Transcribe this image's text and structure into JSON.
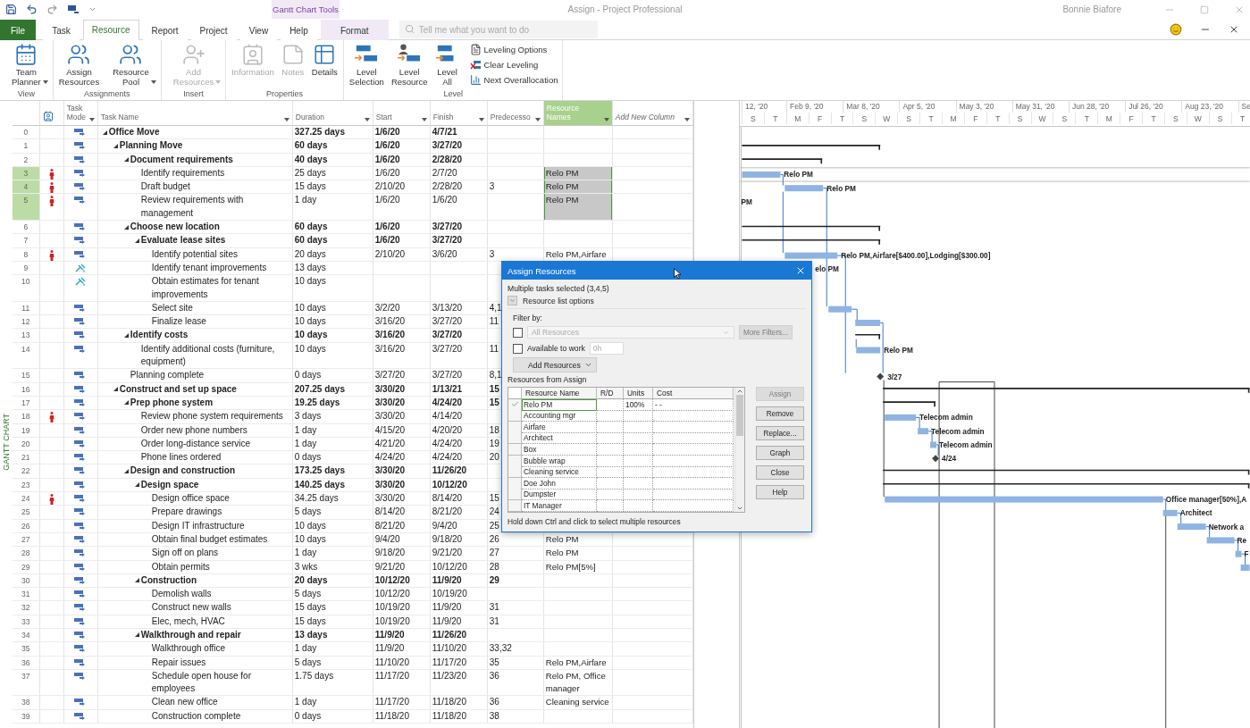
{
  "title_bar": {
    "context_group": "Gantt Chart Tools",
    "title": "Assign - Project Professional",
    "user": "Bonnie Biafore"
  },
  "tabs": [
    {
      "label": "File",
      "kind": "file",
      "selected": false
    },
    {
      "label": "Task",
      "kind": "normal",
      "selected": false
    },
    {
      "label": "Resource",
      "kind": "normal",
      "selected": true
    },
    {
      "label": "Report",
      "kind": "normal",
      "selected": false
    },
    {
      "label": "Project",
      "kind": "normal",
      "selected": false
    },
    {
      "label": "View",
      "kind": "normal",
      "selected": false
    },
    {
      "label": "Help",
      "kind": "normal",
      "selected": false
    },
    {
      "label": "Format",
      "kind": "context",
      "selected": false
    }
  ],
  "search": {
    "placeholder": "Tell me what you want to do"
  },
  "ribbon_groups": [
    {
      "label": "View",
      "buttons": [
        {
          "label": "Team Planner",
          "dropdown": true,
          "disabled": false
        }
      ]
    },
    {
      "label": "Assignments",
      "buttons": [
        {
          "label": "Assign Resources",
          "dropdown": false,
          "disabled": false
        },
        {
          "label": "Resource Pool",
          "dropdown": true,
          "disabled": false
        }
      ]
    },
    {
      "label": "Insert",
      "buttons": [
        {
          "label": "Add Resources",
          "dropdown": true,
          "disabled": true
        }
      ]
    },
    {
      "label": "Properties",
      "buttons": [
        {
          "label": "Information",
          "dropdown": false,
          "disabled": true
        },
        {
          "label": "Notes",
          "dropdown": false,
          "disabled": true
        },
        {
          "label": "Details",
          "dropdown": false,
          "disabled": false
        }
      ]
    },
    {
      "label": "Level",
      "buttons": [
        {
          "label": "Level Selection",
          "dropdown": false,
          "disabled": false
        },
        {
          "label": "Level Resource",
          "dropdown": false,
          "disabled": false
        },
        {
          "label": "Level All",
          "dropdown": false,
          "disabled": false
        }
      ],
      "small_buttons": [
        {
          "label": "Leveling Options"
        },
        {
          "label": "Clear Leveling"
        },
        {
          "label": "Next Overallocation"
        }
      ]
    }
  ],
  "view_label": "GANTT CHART",
  "table": {
    "columns": [
      {
        "label": "Task Mode",
        "selected": false
      },
      {
        "label": "Task Name",
        "selected": false
      },
      {
        "label": "Duration",
        "selected": false
      },
      {
        "label": "Start",
        "selected": false
      },
      {
        "label": "Finish",
        "selected": false
      },
      {
        "label": "Predecesso",
        "selected": false
      },
      {
        "label": "Resource Names",
        "selected": true
      },
      {
        "label": "Add New Column",
        "selected": false
      }
    ],
    "tasks": [
      {
        "id": "0",
        "kind": "auto",
        "name": "Office Move",
        "duration": "327.25 days",
        "start": "1/6/20",
        "finish": "4/7/21",
        "overallocated": false,
        "selected": false,
        "expanded": true,
        "children": [
          {
            "id": "1",
            "kind": "auto",
            "name": "Planning Move",
            "duration": "60 days",
            "start": "1/6/20",
            "finish": "3/27/20",
            "overallocated": false,
            "selected": false,
            "expanded": true,
            "children": [
              {
                "id": "2",
                "kind": "auto",
                "name": "Document requirements",
                "duration": "40 days",
                "start": "1/6/20",
                "finish": "2/28/20",
                "overallocated": false,
                "selected": false,
                "expanded": true,
                "children": [
                  {
                    "id": "3",
                    "kind": "auto",
                    "name": "Identify requirements",
                    "duration": "25 days",
                    "start": "1/6/20",
                    "finish": "2/7/20",
                    "resources": "Relo PM",
                    "overallocated": true,
                    "selected": true
                  },
                  {
                    "id": "4",
                    "kind": "auto",
                    "name": "Draft budget",
                    "duration": "15 days",
                    "start": "2/10/20",
                    "finish": "2/28/20",
                    "predecessors": "3",
                    "resources": "Relo PM",
                    "overallocated": true,
                    "selected": true
                  },
                  {
                    "id": "5",
                    "kind": "auto",
                    "name": "Review requirements with management",
                    "duration": "1 day",
                    "start": "1/6/20",
                    "finish": "1/6/20",
                    "resources": "Relo PM",
                    "overallocated": true,
                    "selected": true
                  }
                ]
              },
              {
                "id": "6",
                "kind": "auto",
                "name": "Choose new location",
                "duration": "60 days",
                "start": "1/6/20",
                "finish": "3/27/20",
                "overallocated": false,
                "selected": false,
                "expanded": true,
                "children": [
                  {
                    "id": "7",
                    "kind": "auto",
                    "name": "Evaluate lease sites",
                    "duration": "60 days",
                    "start": "1/6/20",
                    "finish": "3/27/20",
                    "overallocated": false,
                    "selected": false,
                    "expanded": true,
                    "children": [
                      {
                        "id": "8",
                        "kind": "auto",
                        "name": "Identify potential sites",
                        "duration": "20 days",
                        "start": "2/10/20",
                        "finish": "3/6/20",
                        "predecessors": "3",
                        "resources": "Relo PM,Airfare",
                        "overallocated": true,
                        "selected": false
                      },
                      {
                        "id": "9",
                        "kind": "manual",
                        "name": "Identify tenant improvements",
                        "duration": "13 days",
                        "overallocated": false,
                        "selected": false
                      },
                      {
                        "id": "10",
                        "kind": "manual",
                        "name": "Obtain estimates for tenant improvements",
                        "duration": "10 days",
                        "overallocated": false,
                        "selected": false
                      },
                      {
                        "id": "11",
                        "kind": "auto",
                        "name": "Select site",
                        "duration": "10 days",
                        "start": "3/2/20",
                        "finish": "3/13/20",
                        "predecessors": "4,1",
                        "overallocated": false,
                        "selected": false
                      },
                      {
                        "id": "12",
                        "kind": "auto",
                        "name": "Finalize lease",
                        "duration": "10 days",
                        "start": "3/16/20",
                        "finish": "3/27/20",
                        "predecessors": "11",
                        "overallocated": false,
                        "selected": false
                      }
                    ]
                  }
                ]
              },
              {
                "id": "13",
                "kind": "auto",
                "name": "Identify costs",
                "duration": "10 days",
                "start": "3/16/20",
                "finish": "3/27/20",
                "overallocated": false,
                "selected": false,
                "expanded": true,
                "children": [
                  {
                    "id": "14",
                    "kind": "auto",
                    "name": "Identify additional costs (furniture, equipment)",
                    "duration": "10 days",
                    "start": "3/16/20",
                    "finish": "3/27/20",
                    "predecessors": "11",
                    "overallocated": false,
                    "selected": false
                  }
                ]
              },
              {
                "id": "15",
                "kind": "auto",
                "name": "Planning complete",
                "duration": "0 days",
                "start": "3/27/20",
                "finish": "3/27/20",
                "predecessors": "8,1",
                "overallocated": false,
                "selected": false
              }
            ]
          },
          {
            "id": "16",
            "kind": "auto",
            "name": "Construct and set up space",
            "duration": "207.25 days",
            "start": "3/30/20",
            "finish": "1/13/21",
            "predecessors": "15",
            "overallocated": false,
            "selected": false,
            "expanded": true,
            "children": [
              {
                "id": "17",
                "kind": "auto",
                "name": "Prep phone system",
                "duration": "19.25 days",
                "start": "3/30/20",
                "finish": "4/24/20",
                "predecessors": "15",
                "overallocated": false,
                "selected": false,
                "expanded": true,
                "children": [
                  {
                    "id": "18",
                    "kind": "auto",
                    "name": "Review phone system requirements",
                    "duration": "3 days",
                    "start": "3/30/20",
                    "finish": "4/14/20",
                    "overallocated": true,
                    "selected": false
                  },
                  {
                    "id": "19",
                    "kind": "auto",
                    "name": "Order new phone numbers",
                    "duration": "1 day",
                    "start": "4/15/20",
                    "finish": "4/20/20",
                    "predecessors": "18",
                    "overallocated": false,
                    "selected": false
                  },
                  {
                    "id": "20",
                    "kind": "auto",
                    "name": "Order long-distance service",
                    "duration": "1 day",
                    "start": "4/21/20",
                    "finish": "4/24/20",
                    "predecessors": "19",
                    "overallocated": false,
                    "selected": false
                  },
                  {
                    "id": "21",
                    "kind": "auto",
                    "name": "Phone lines ordered",
                    "duration": "0 days",
                    "start": "4/24/20",
                    "finish": "4/24/20",
                    "predecessors": "20",
                    "overallocated": false,
                    "selected": false
                  }
                ]
              },
              {
                "id": "22",
                "kind": "auto",
                "name": "Design and construction",
                "duration": "173.25 days",
                "start": "3/30/20",
                "finish": "11/26/20",
                "overallocated": false,
                "selected": false,
                "expanded": true,
                "children": [
                  {
                    "id": "23",
                    "kind": "auto",
                    "name": "Design space",
                    "duration": "140.25 days",
                    "start": "3/30/20",
                    "finish": "10/12/20",
                    "overallocated": false,
                    "selected": false,
                    "expanded": true,
                    "children": [
                      {
                        "id": "24",
                        "kind": "auto",
                        "name": "Design office space",
                        "duration": "34.25 days",
                        "start": "3/30/20",
                        "finish": "8/14/20",
                        "predecessors": "15",
                        "overallocated": true,
                        "selected": false
                      },
                      {
                        "id": "25",
                        "kind": "auto",
                        "name": "Prepare drawings",
                        "duration": "5 days",
                        "start": "8/14/20",
                        "finish": "8/21/20",
                        "predecessors": "24",
                        "overallocated": false,
                        "selected": false
                      },
                      {
                        "id": "26",
                        "kind": "auto",
                        "name": "Design IT infrastructure",
                        "duration": "10 days",
                        "start": "8/21/20",
                        "finish": "9/4/20",
                        "predecessors": "25",
                        "overallocated": false,
                        "selected": false
                      },
                      {
                        "id": "27",
                        "kind": "auto",
                        "name": "Obtain final budget estimates",
                        "duration": "10 days",
                        "start": "9/4/20",
                        "finish": "9/18/20",
                        "predecessors": "26",
                        "resources": "Relo PM",
                        "overallocated": false,
                        "selected": false
                      },
                      {
                        "id": "28",
                        "kind": "auto",
                        "name": "Sign off on plans",
                        "duration": "1 day",
                        "start": "9/18/20",
                        "finish": "9/21/20",
                        "predecessors": "27",
                        "resources": "Relo PM",
                        "overallocated": false,
                        "selected": false
                      },
                      {
                        "id": "29",
                        "kind": "auto",
                        "name": "Obtain permits",
                        "duration": "3 wks",
                        "start": "9/21/20",
                        "finish": "10/12/20",
                        "predecessors": "28",
                        "resources": "Relo PM[5%]",
                        "overallocated": false,
                        "selected": false
                      }
                    ]
                  },
                  {
                    "id": "30",
                    "kind": "auto",
                    "name": "Construction",
                    "duration": "20 days",
                    "start": "10/12/20",
                    "finish": "11/9/20",
                    "predecessors": "29",
                    "overallocated": false,
                    "selected": false,
                    "expanded": true,
                    "children": [
                      {
                        "id": "31",
                        "kind": "auto",
                        "name": "Demolish walls",
                        "duration": "5 days",
                        "start": "10/12/20",
                        "finish": "10/19/20",
                        "overallocated": false,
                        "selected": false
                      },
                      {
                        "id": "32",
                        "kind": "auto",
                        "name": "Construct new walls",
                        "duration": "15 days",
                        "start": "10/19/20",
                        "finish": "11/9/20",
                        "predecessors": "31",
                        "overallocated": false,
                        "selected": false
                      },
                      {
                        "id": "33",
                        "kind": "auto",
                        "name": "Elec, mech, HVAC",
                        "duration": "15 days",
                        "start": "10/19/20",
                        "finish": "11/9/20",
                        "predecessors": "31",
                        "overallocated": false,
                        "selected": false
                      }
                    ]
                  },
                  {
                    "id": "34",
                    "kind": "auto",
                    "name": "Walkthrough and repair",
                    "duration": "13 days",
                    "start": "11/9/20",
                    "finish": "11/26/20",
                    "overallocated": false,
                    "selected": false,
                    "expanded": true,
                    "children": [
                      {
                        "id": "35",
                        "kind": "auto",
                        "name": "Walkthrough office",
                        "duration": "1 day",
                        "start": "11/9/20",
                        "finish": "11/10/20",
                        "predecessors": "33,32",
                        "overallocated": false,
                        "selected": false
                      },
                      {
                        "id": "36",
                        "kind": "auto",
                        "name": "Repair issues",
                        "duration": "5 days",
                        "start": "11/10/20",
                        "finish": "11/17/20",
                        "predecessors": "35",
                        "resources": "Relo PM,Airfare",
                        "overallocated": false,
                        "selected": false
                      },
                      {
                        "id": "37",
                        "kind": "auto",
                        "name": "Schedule open house for employees",
                        "duration": "1.75 days",
                        "start": "11/17/20",
                        "finish": "11/23/20",
                        "predecessors": "36",
                        "resources": "Relo PM, Office manager",
                        "overallocated": false,
                        "selected": false
                      },
                      {
                        "id": "38",
                        "kind": "auto",
                        "name": "Clean new office",
                        "duration": "1 day",
                        "start": "11/17/20",
                        "finish": "11/18/20",
                        "predecessors": "36",
                        "resources": "Cleaning service",
                        "overallocated": false,
                        "selected": false
                      },
                      {
                        "id": "39",
                        "kind": "auto",
                        "name": "Construction complete",
                        "duration": "0 days",
                        "start": "11/18/20",
                        "finish": "11/18/20",
                        "predecessors": "38",
                        "overallocated": false,
                        "selected": false
                      }
                    ]
                  }
                ]
              }
            ]
          }
        ]
      }
    ]
  },
  "gantt": {
    "date_labels": [
      "12, '20",
      "Feb 9, '20",
      "Mar 8, '20",
      "Apr 5, '20",
      "May 3, '20",
      "May 31, '20",
      "Jun 28, '20",
      "Jul 26, '20",
      "Aug 23, '20",
      "Se"
    ],
    "day_letters": [
      "S",
      "T",
      "M",
      "F",
      "T",
      "S",
      "W",
      "S",
      "T",
      "M",
      "F",
      "T",
      "S",
      "W",
      "S",
      "T",
      "M",
      "F",
      "T",
      "S",
      "W",
      "S",
      "T"
    ],
    "bar_labels": [
      "Relo PM",
      "Relo PM",
      "PM",
      "Relo PM,Airfare[$400.00],Lodging[$300.00]",
      "elo PM",
      "Relo PM",
      "3/27",
      "Telecom admin",
      "Telecom admin",
      "Telecom admin",
      "4/24",
      "Office manager[50%],A",
      "Architect",
      "Network a",
      "Re",
      "F"
    ]
  },
  "dialog": {
    "title": "Assign Resources",
    "selection_note": "Multiple tasks selected (3,4,5)",
    "options_toggle": "Resource list options",
    "filter_label": "Filter by:",
    "filter_checked": false,
    "filter_value": "All Resources",
    "more_filters": "More Filters...",
    "available_label": "Available to work",
    "available_checked": false,
    "available_value": "0h",
    "add_resources": "Add Resources",
    "list_label": "Resources from Assign",
    "grid_columns": [
      "Resource Name",
      "R/D",
      "Units",
      "Cost"
    ],
    "resources": [
      {
        "name": "Relo PM",
        "assigned": true,
        "selected": true,
        "units": "100%",
        "cost": "- -"
      },
      {
        "name": "Accounting mgr",
        "assigned": false,
        "selected": false
      },
      {
        "name": "Airfare",
        "assigned": false,
        "selected": false
      },
      {
        "name": "Architect",
        "assigned": false,
        "selected": false
      },
      {
        "name": "Box",
        "assigned": false,
        "selected": false
      },
      {
        "name": "Bubble wrap",
        "assigned": false,
        "selected": false
      },
      {
        "name": "Cleaning service",
        "assigned": false,
        "selected": false
      },
      {
        "name": "Doe John",
        "assigned": false,
        "selected": false
      },
      {
        "name": "Dumpster",
        "assigned": false,
        "selected": false
      },
      {
        "name": "IT Manager",
        "assigned": false,
        "selected": false
      }
    ],
    "buttons": [
      {
        "label": "Assign",
        "disabled": true
      },
      {
        "label": "Remove",
        "disabled": false
      },
      {
        "label": "Replace...",
        "disabled": false
      },
      {
        "label": "Graph",
        "disabled": false
      },
      {
        "label": "Close",
        "disabled": false
      },
      {
        "label": "Help",
        "disabled": false
      }
    ],
    "hint": "Hold down Ctrl and click to select multiple resources"
  }
}
